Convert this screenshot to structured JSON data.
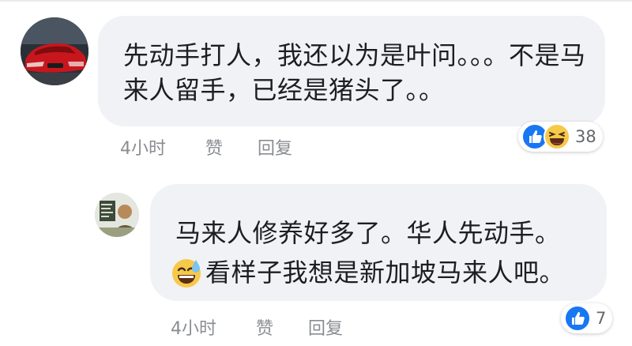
{
  "comment": {
    "text": "先动手打人，我还以为是叶问。。。不是马来人留手，已经是猪头了。。",
    "actions": {
      "time": "4小时",
      "like": "赞",
      "reply": "回复"
    },
    "reactions": {
      "icons": [
        "like-icon",
        "haha-icon"
      ],
      "count": "38"
    }
  },
  "reply": {
    "line1": "马来人修养好多了。华人先动手。",
    "line2": "看样子我想是新加坡马来人吧。",
    "line2_emoji": "sweat-smile-icon",
    "actions": {
      "time": "4小时",
      "like": "赞",
      "reply": "回复"
    },
    "reactions": {
      "icons": [
        "like-icon"
      ],
      "count": "7"
    }
  },
  "colors": {
    "bubble": "#f0f2f5",
    "text": "#1c1e21",
    "meta": "#8a8d91",
    "like_blue": "#1877f2",
    "haha_yellow": "#f7c948"
  }
}
